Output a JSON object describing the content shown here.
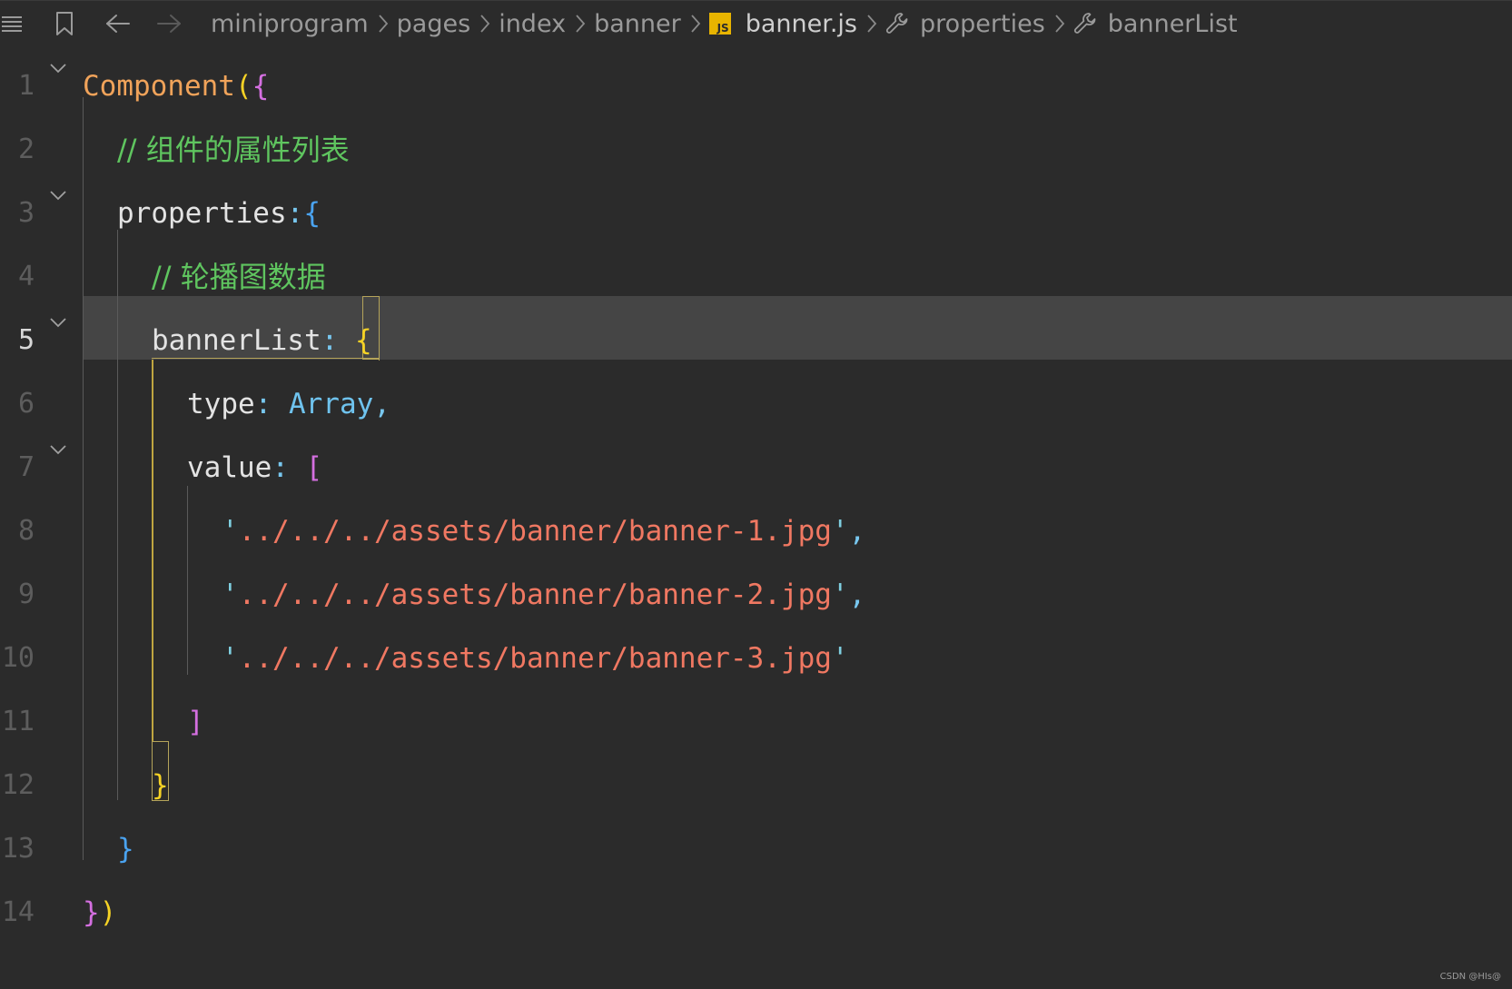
{
  "breadcrumb": {
    "items": [
      "miniprogram",
      "pages",
      "index",
      "banner",
      "banner.js",
      "properties",
      "bannerList"
    ],
    "file_badge": "JS"
  },
  "gutter": {
    "line_numbers": [
      "1",
      "2",
      "3",
      "4",
      "5",
      "6",
      "7",
      "8",
      "9",
      "10",
      "11",
      "12",
      "13",
      "14"
    ],
    "current_line": "5"
  },
  "code": {
    "l1": {
      "fn": "Component",
      "p1": "(",
      "b1": "{"
    },
    "l2": {
      "comment": "// 组件的属性列表"
    },
    "l3": {
      "key": "properties",
      "colon": ":",
      "brace": "{"
    },
    "l4": {
      "comment": "// 轮播图数据"
    },
    "l5": {
      "key": "bannerList",
      "colon": ": ",
      "brace": "{"
    },
    "l6": {
      "key": "type",
      "colon": ": ",
      "type": "Array",
      "comma": ","
    },
    "l7": {
      "key": "value",
      "colon": ": ",
      "bracket": "["
    },
    "l8": {
      "q1": "'",
      "str": "../../../assets/banner/banner-1.jpg",
      "q2": "'",
      "comma": ","
    },
    "l9": {
      "q1": "'",
      "str": "../../../assets/banner/banner-2.jpg",
      "q2": "'",
      "comma": ","
    },
    "l10": {
      "q1": "'",
      "str": "../../../assets/banner/banner-3.jpg",
      "q2": "'"
    },
    "l11": {
      "bracket": "]"
    },
    "l12": {
      "brace": "}"
    },
    "l13": {
      "brace": "}"
    },
    "l14": {
      "b1": "}",
      "p1": ")"
    }
  },
  "watermark": "CSDN @HIs@",
  "colors": {
    "background": "#2b2b2b",
    "current_line": "#454545",
    "function": "#f0a35a",
    "comment": "#5fc55f",
    "string": "#f07862",
    "type": "#6fc3ee",
    "bracket_yellow": "#f5d225",
    "bracket_magenta": "#d46fe0",
    "bracket_blue": "#4aa3f0"
  }
}
